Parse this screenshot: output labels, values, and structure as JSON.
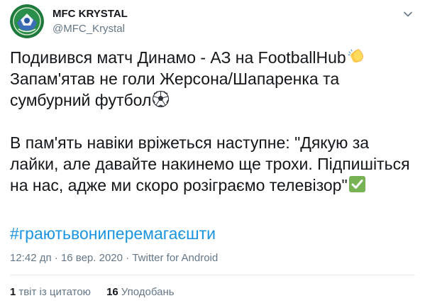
{
  "author": {
    "name": "MFC KRYSTAL",
    "handle": "@MFC_Krystal"
  },
  "tweet": {
    "paragraph1_lines": [
      "Подивився матч Динамо - АЗ на FootballHub",
      "Запам'ятав не голи Жерсона/Шапаренка та",
      "сумбурний футбол"
    ],
    "paragraph2_lines": [
      "В пам'ять навіки вріжеться наступне: \"Дякую за",
      "лайки, але давайте накинемо ще трохи. Підпишіться",
      "на нас, адже ми скоро розіграємо телевізор\""
    ],
    "hashtag": "#граютьвониперемагаєшти",
    "emojis": [
      "clapping-hands-emoji",
      "soccer-ball-emoji",
      "check-mark-emoji"
    ]
  },
  "meta": {
    "time": "12:42 дп",
    "separator": " · ",
    "date": "16 вер. 2020",
    "source": "Twitter for Android"
  },
  "stats": {
    "quote_tweets_count": "1",
    "quote_tweets_label": "твіт із цитатою",
    "likes_count": "16",
    "likes_label": "Уподобань"
  },
  "colors": {
    "text": "#14171a",
    "secondary": "#657786",
    "link": "#1b95e0",
    "divider": "#e6ecf0",
    "check_green": "#77b255"
  }
}
